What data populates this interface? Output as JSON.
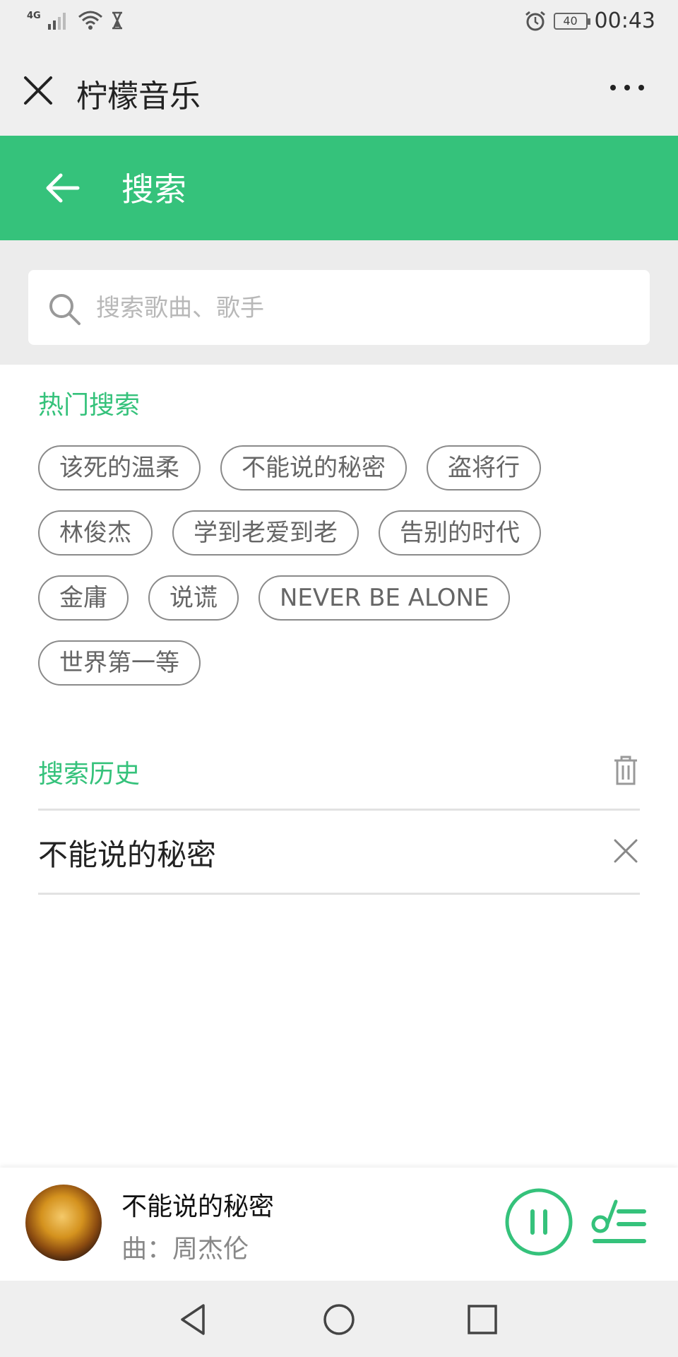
{
  "status_bar": {
    "network": "4G",
    "battery": "40",
    "time": "00:43"
  },
  "title_bar": {
    "title": "柠檬音乐"
  },
  "header": {
    "title": "搜索"
  },
  "search": {
    "placeholder": "搜索歌曲、歌手",
    "value": ""
  },
  "hot_search": {
    "label": "热门搜索",
    "tags": [
      "该死的温柔",
      "不能说的秘密",
      "盗将行",
      "林俊杰",
      "学到老爱到老",
      "告别的时代",
      "金庸",
      "说谎",
      "NEVER BE ALONE",
      "世界第一等"
    ]
  },
  "history": {
    "label": "搜索历史",
    "items": [
      "不能说的秘密"
    ]
  },
  "player": {
    "song_title": "不能说的秘密",
    "artist": "曲：周杰伦"
  },
  "colors": {
    "accent": "#35c27b",
    "status_bar_bg": "#efefef",
    "search_area_bg": "#ececec"
  },
  "icons": {
    "close": "close-icon",
    "more": "more-dots-icon",
    "back": "back-arrow-icon",
    "search": "search-icon",
    "trash": "trash-icon",
    "remove": "close-icon",
    "pause": "pause-icon",
    "playlist": "playlist-icon"
  }
}
